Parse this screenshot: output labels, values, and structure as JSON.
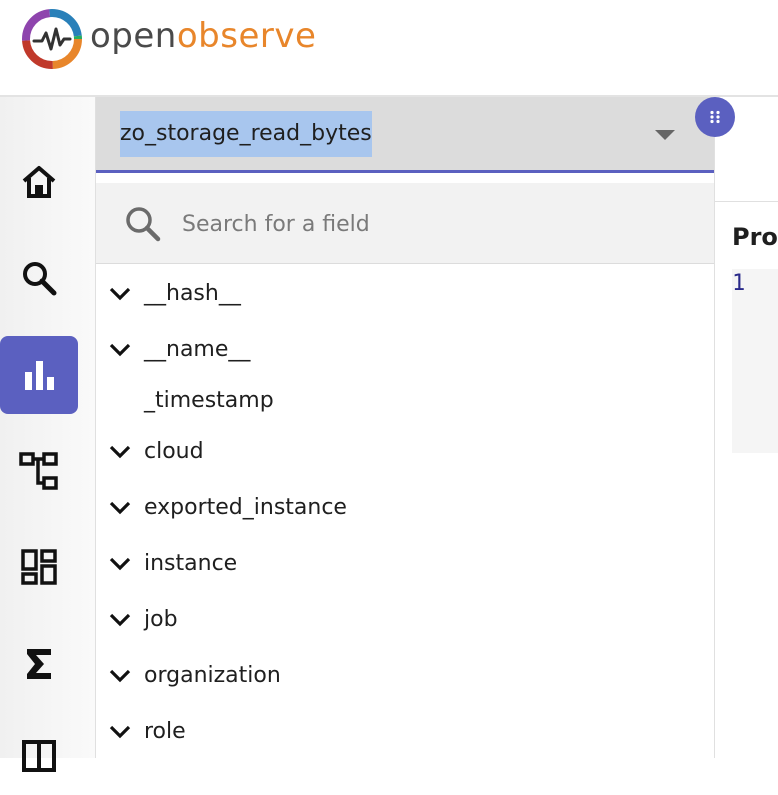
{
  "brand": {
    "name_part1": "open",
    "name_part2": "observe",
    "color_dark": "#4a4a4a",
    "color_accent": "#e8862b"
  },
  "theme": {
    "primary": "#5b60c0",
    "select_highlight": "#a8c6ee"
  },
  "sidebar": {
    "items": [
      {
        "name": "home",
        "icon": "home-icon",
        "active": false
      },
      {
        "name": "search",
        "icon": "search-icon",
        "active": false
      },
      {
        "name": "metrics",
        "icon": "bar-chart-icon",
        "active": true
      },
      {
        "name": "traces",
        "icon": "hierarchy-icon",
        "active": false
      },
      {
        "name": "dashboards",
        "icon": "dashboard-icon",
        "active": false
      },
      {
        "name": "functions",
        "icon": "sigma-icon",
        "active": false
      },
      {
        "name": "more",
        "icon": "table-icon",
        "active": false
      }
    ]
  },
  "metric_select": {
    "value": "zo_storage_read_bytes",
    "arrow_icon": "caret-down-icon"
  },
  "field_search": {
    "placeholder": "Search for a field",
    "value": ""
  },
  "fields": [
    {
      "label": "__hash__",
      "expandable": true
    },
    {
      "label": "__name__",
      "expandable": true
    },
    {
      "label": "_timestamp",
      "expandable": false
    },
    {
      "label": "cloud",
      "expandable": true
    },
    {
      "label": "exported_instance",
      "expandable": true
    },
    {
      "label": "instance",
      "expandable": true
    },
    {
      "label": "job",
      "expandable": true
    },
    {
      "label": "organization",
      "expandable": true
    },
    {
      "label": "role",
      "expandable": true
    }
  ],
  "query_editor": {
    "header": "Pro",
    "line_number": "1"
  }
}
